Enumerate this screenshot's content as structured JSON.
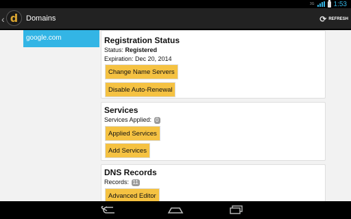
{
  "status_bar": {
    "signal_text": "3G",
    "time": "1:53"
  },
  "action_bar": {
    "logo_letter": "d",
    "title": "Domains",
    "refresh_label": "REFRESH"
  },
  "sidebar": {
    "items": [
      {
        "label": "google.com",
        "selected": true
      }
    ]
  },
  "registration": {
    "title": "Registration Status",
    "status_label": "Status:",
    "status_value": "Registered",
    "expiration": "Expiration: Dec 20, 2014",
    "buttons": {
      "change_name_servers": "Change Name Servers",
      "disable_auto_renewal": "Disable Auto-Renewal"
    }
  },
  "services": {
    "title": "Services",
    "applied_label": "Services Applied:",
    "applied_count": "0",
    "buttons": {
      "applied_services": "Applied Services",
      "add_services": "Add Services"
    }
  },
  "dns": {
    "title": "DNS Records",
    "records_label": "Records:",
    "records_count": "11",
    "buttons": {
      "advanced_editor": "Advanced Editor"
    }
  },
  "colors": {
    "accent": "#33b5e5",
    "button": "#f5c242"
  },
  "icons": [
    "back-chevron-icon",
    "app-logo-icon",
    "refresh-icon",
    "nav-back-icon",
    "nav-home-icon",
    "nav-recents-icon"
  ]
}
